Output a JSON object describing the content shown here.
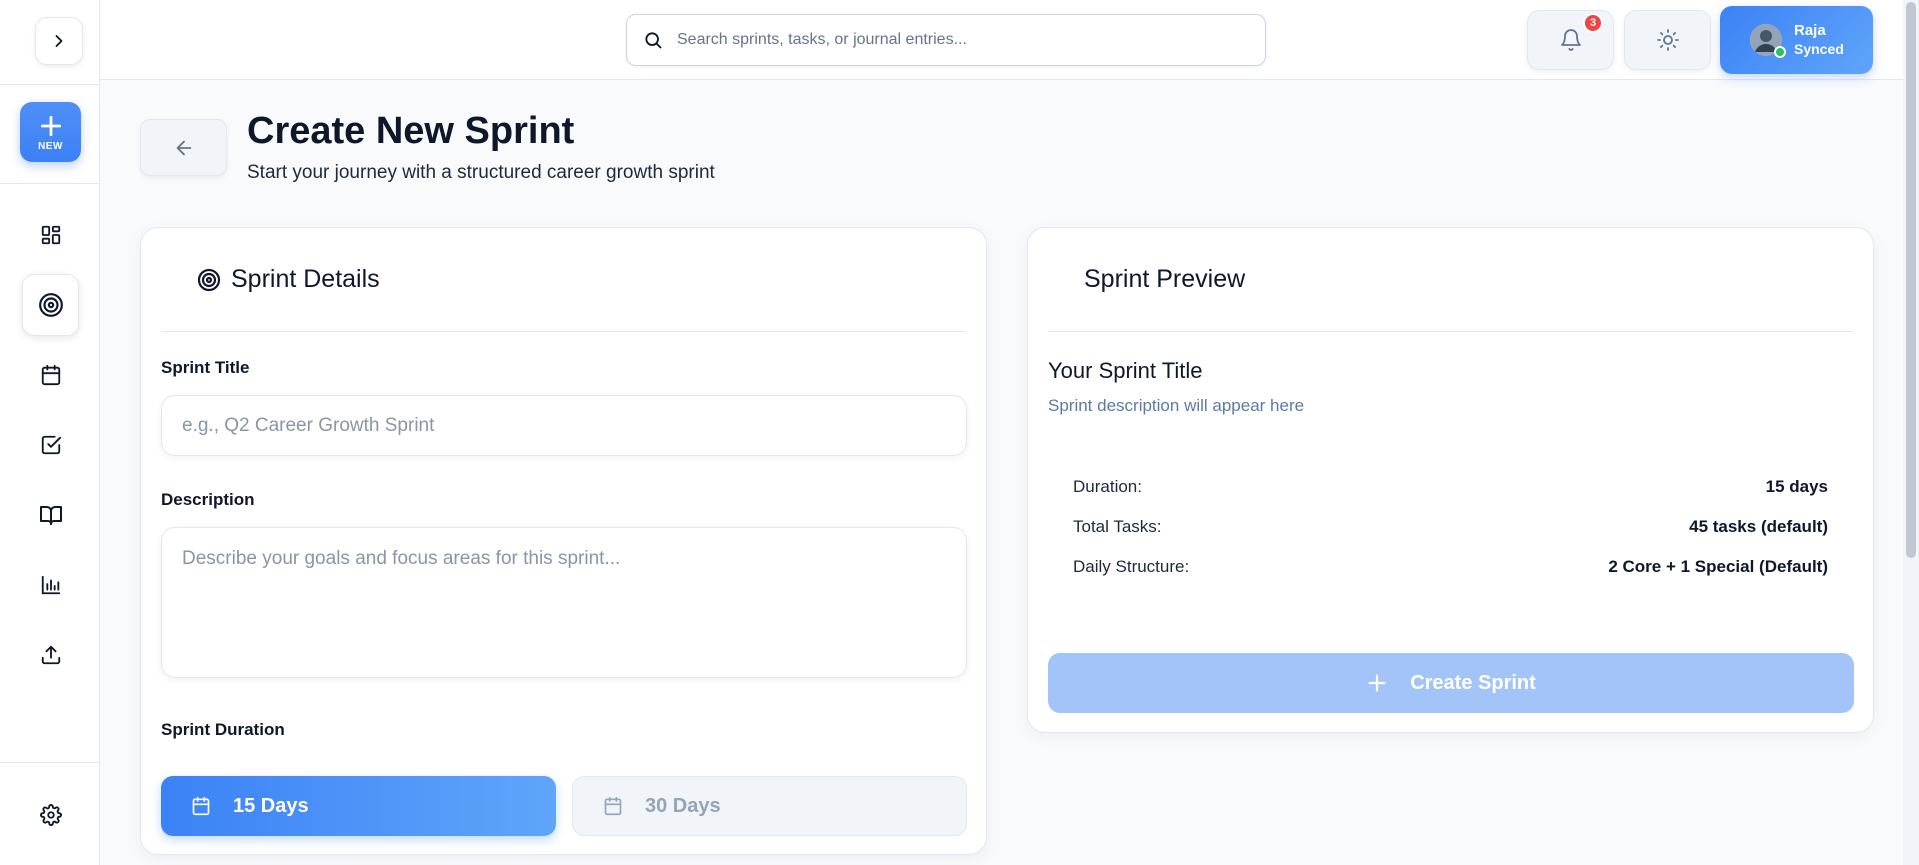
{
  "sidebar": {
    "toggle_icon": "chevron-right-icon",
    "new_label": "NEW",
    "items": [
      {
        "name": "dashboard",
        "icon": "grid-icon"
      },
      {
        "name": "sprints",
        "icon": "target-icon",
        "active": true
      },
      {
        "name": "calendar",
        "icon": "calendar-icon"
      },
      {
        "name": "tasks",
        "icon": "checkbox-icon"
      },
      {
        "name": "journal",
        "icon": "book-open-icon"
      },
      {
        "name": "analytics",
        "icon": "bar-chart-icon"
      },
      {
        "name": "export",
        "icon": "upload-icon"
      }
    ],
    "settings_icon": "gear-icon"
  },
  "header": {
    "search_placeholder": "Search sprints, tasks, or journal entries...",
    "notification_count": "3",
    "user": {
      "name": "Raja",
      "status": "Synced"
    }
  },
  "page": {
    "title": "Create New Sprint",
    "subtitle": "Start your journey with a structured career growth sprint"
  },
  "details": {
    "heading": "Sprint Details",
    "title_label": "Sprint Title",
    "title_placeholder": "e.g., Q2 Career Growth Sprint",
    "title_value": "",
    "description_label": "Description",
    "description_placeholder": "Describe your goals and focus areas for this sprint...",
    "description_value": "",
    "duration_label": "Sprint Duration",
    "duration_options": [
      {
        "label": "15 Days",
        "selected": true
      },
      {
        "label": "30 Days",
        "selected": false
      }
    ]
  },
  "preview": {
    "heading": "Sprint Preview",
    "sprint_title": "Your Sprint Title",
    "sprint_description": "Sprint description will appear here",
    "stats": [
      {
        "label": "Duration:",
        "value": "15 days"
      },
      {
        "label": "Total Tasks:",
        "value": "45 tasks (default)"
      },
      {
        "label": "Daily Structure:",
        "value": "2 Core + 1 Special (Default)"
      }
    ],
    "create_label": "Create Sprint"
  },
  "colors": {
    "accent": "#3b82f6",
    "accent_disabled": "#a3c4f8",
    "badge": "#ef4444",
    "online": "#22c55e",
    "muted_text": "#5b7aa5"
  }
}
